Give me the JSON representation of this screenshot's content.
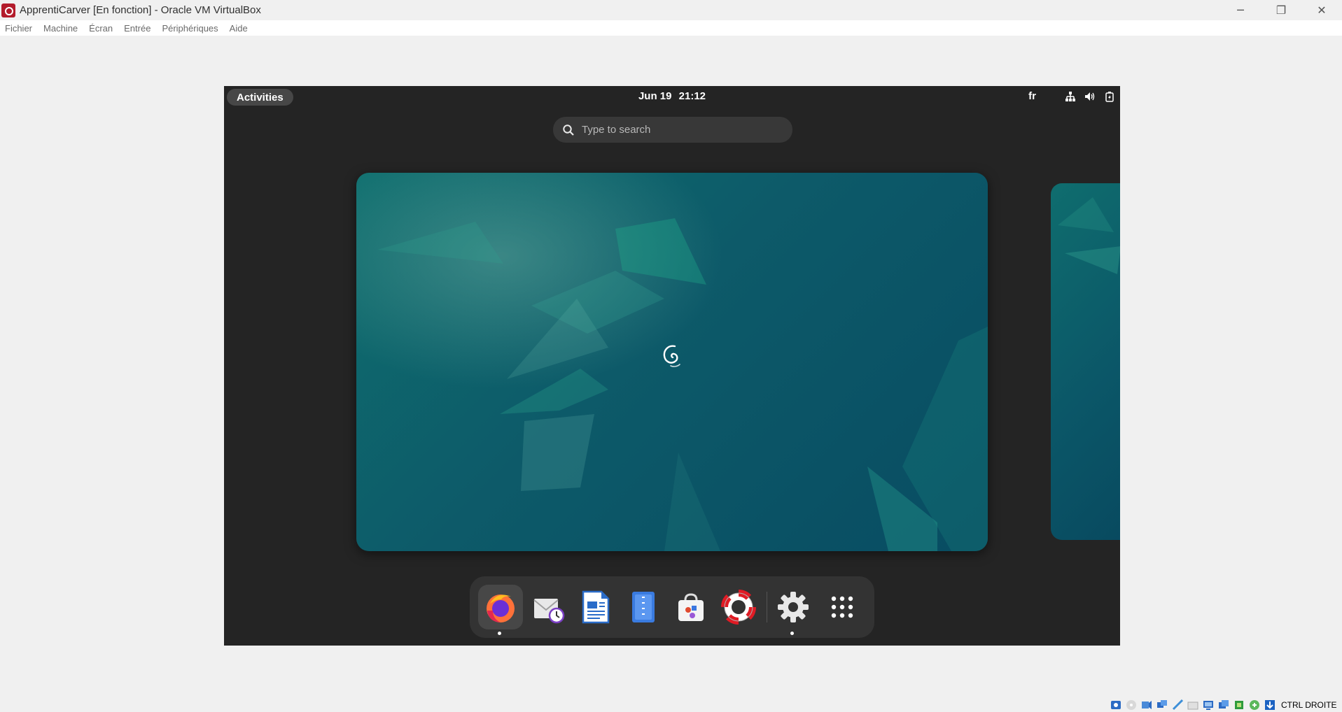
{
  "window": {
    "title": "ApprentiCarver [En fonction] - Oracle VM VirtualBox",
    "controls": {
      "minimize": "─",
      "restore": "❐",
      "close": "✕"
    }
  },
  "menu": {
    "items": [
      "Fichier",
      "Machine",
      "Écran",
      "Entrée",
      "Périphériques",
      "Aide"
    ]
  },
  "gnome": {
    "activities_label": "Activities",
    "date": "Jun 19",
    "time": "21:12",
    "keyboard_layout": "fr",
    "search_placeholder": "Type to search",
    "tray_icons": [
      "network-icon",
      "volume-icon",
      "battery-icon"
    ]
  },
  "dock": {
    "apps": [
      "firefox-icon",
      "evolution-mail-icon",
      "libreoffice-writer-icon",
      "file-roller-icon",
      "software-store-icon",
      "help-lifebuoy-icon",
      "settings-gear-icon",
      "show-apps-grid-icon"
    ]
  },
  "statusbar": {
    "host_key_label": "CTRL DROITE",
    "icons": [
      "hard-disk-icon",
      "optical-drive-icon",
      "audio-icon",
      "network-adapters-icon",
      "usb-icon",
      "shared-folders-icon",
      "display-icon",
      "video-capture-icon",
      "cpu-icon",
      "mouse-integration-icon",
      "host-key-arrow-icon"
    ]
  },
  "colors": {
    "vm_background": "#242424",
    "wallpaper": "#0b5a6a",
    "accent_teal": "#1aa08a"
  }
}
